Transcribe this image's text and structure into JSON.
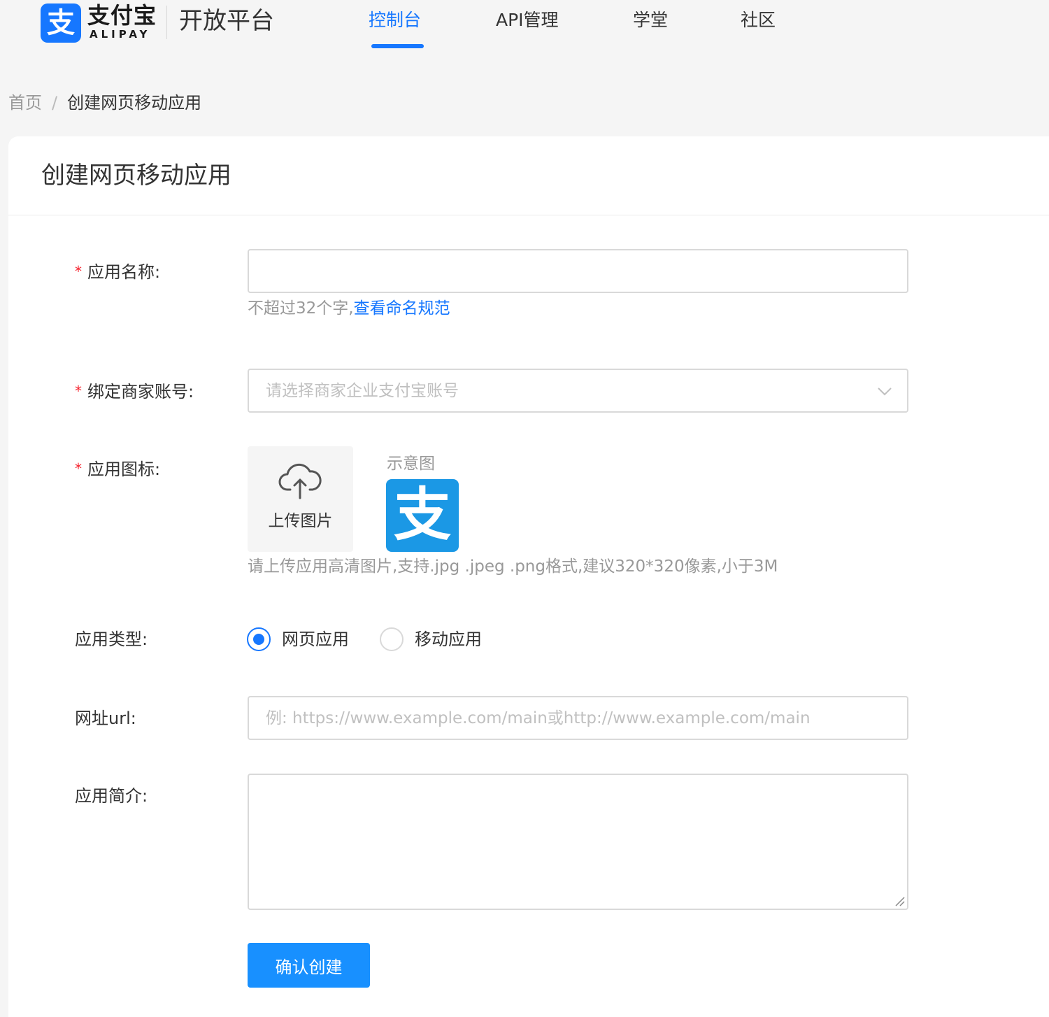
{
  "header": {
    "logo_mark": "支",
    "logo_cn": "支付宝",
    "logo_en": "ALIPAY",
    "platform": "开放平台",
    "nav": [
      {
        "label": "控制台",
        "active": true
      },
      {
        "label": "API管理",
        "active": false
      },
      {
        "label": "学堂",
        "active": false
      },
      {
        "label": "社区",
        "active": false
      }
    ],
    "accent_color": "#1677ff"
  },
  "breadcrumb": {
    "home": "首页",
    "separator": "/",
    "current": "创建网页移动应用"
  },
  "card": {
    "title": "创建网页移动应用"
  },
  "form": {
    "required_mark": "*",
    "app_name": {
      "label": "应用名称:",
      "value": "",
      "hint": "不超过32个字,",
      "hint_link": "查看命名规范"
    },
    "merchant": {
      "label": "绑定商家账号:",
      "placeholder": "请选择商家企业支付宝账号"
    },
    "icon": {
      "label": "应用图标:",
      "upload_text": "上传图片",
      "sample_label": "示意图",
      "sample_glyph": "支",
      "hint": "请上传应用高清图片,支持.jpg .jpeg .png格式,建议320*320像素,小于3M"
    },
    "app_type": {
      "label": "应用类型:",
      "options": [
        {
          "label": "网页应用",
          "checked": true
        },
        {
          "label": "移动应用",
          "checked": false
        }
      ]
    },
    "url": {
      "label": "网址url:",
      "placeholder": "例: https://www.example.com/main或http://www.example.com/main"
    },
    "intro": {
      "label": "应用简介:",
      "value": ""
    },
    "submit_label": "确认创建"
  }
}
